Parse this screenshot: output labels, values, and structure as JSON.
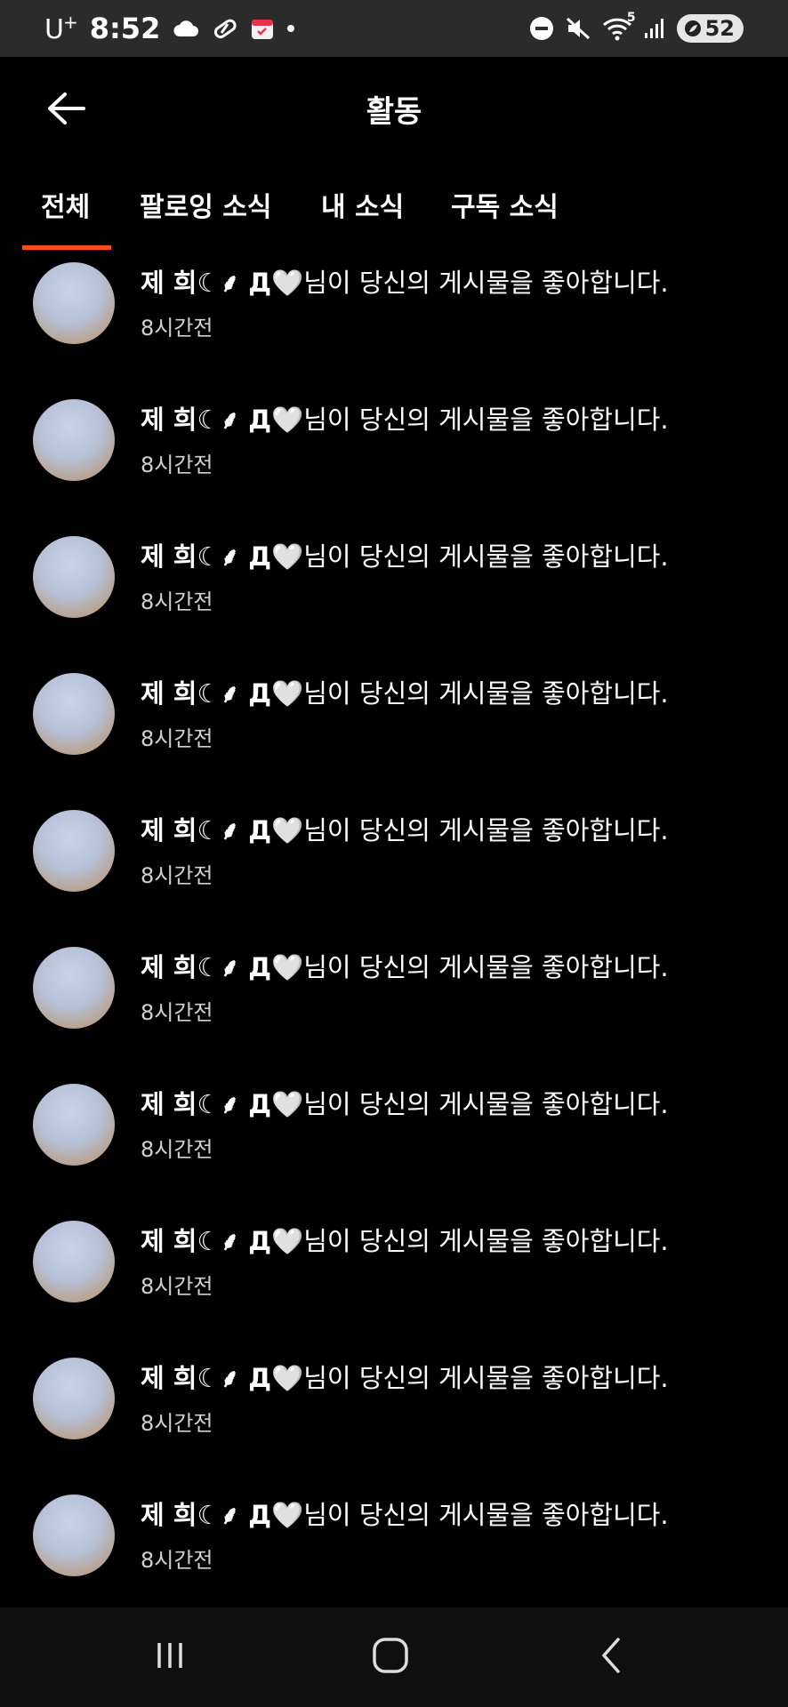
{
  "status_bar": {
    "carrier": "U",
    "carrier_sup": "+",
    "time": "8:52",
    "wifi_badge": "5",
    "battery": "52",
    "icons_left": [
      "cloud-icon",
      "pill-icon",
      "calendar-icon",
      "dot-icon"
    ],
    "icons_right": [
      "do-not-disturb-icon",
      "mute-icon",
      "wifi-icon",
      "signal-icon",
      "battery-icon"
    ]
  },
  "header": {
    "title": "활동"
  },
  "tabs": [
    {
      "label": "전체",
      "active": true
    },
    {
      "label": "팔로잉 소식",
      "active": false
    },
    {
      "label": "내 소식",
      "active": false
    },
    {
      "label": "구독 소식",
      "active": false
    }
  ],
  "notifications": [
    {
      "user": "제 희☾⸙ Д",
      "heart": "🤍",
      "message": "님이 당신의 게시물을 좋아합니다.",
      "time": "8시간전"
    },
    {
      "user": "제 희☾⸙ Д",
      "heart": "🤍",
      "message": "님이 당신의 게시물을 좋아합니다.",
      "time": "8시간전"
    },
    {
      "user": "제 희☾⸙ Д",
      "heart": "🤍",
      "message": "님이 당신의 게시물을 좋아합니다.",
      "time": "8시간전"
    },
    {
      "user": "제 희☾⸙ Д",
      "heart": "🤍",
      "message": "님이 당신의 게시물을 좋아합니다.",
      "time": "8시간전"
    },
    {
      "user": "제 희☾⸙ Д",
      "heart": "🤍",
      "message": "님이 당신의 게시물을 좋아합니다.",
      "time": "8시간전"
    },
    {
      "user": "제 희☾⸙ Д",
      "heart": "🤍",
      "message": "님이 당신의 게시물을 좋아합니다.",
      "time": "8시간전"
    },
    {
      "user": "제 희☾⸙ Д",
      "heart": "🤍",
      "message": "님이 당신의 게시물을 좋아합니다.",
      "time": "8시간전"
    },
    {
      "user": "제 희☾⸙ Д",
      "heart": "🤍",
      "message": "님이 당신의 게시물을 좋아합니다.",
      "time": "8시간전"
    },
    {
      "user": "제 희☾⸙ Д",
      "heart": "🤍",
      "message": "님이 당신의 게시물을 좋아합니다.",
      "time": "8시간전"
    },
    {
      "user": "제 희☾⸙ Д",
      "heart": "🤍",
      "message": "님이 당신의 게시물을 좋아합니다.",
      "time": "8시간전"
    }
  ],
  "colors": {
    "background": "#000000",
    "accent": "#ff4b1f",
    "status_bar": "#2b2b2b",
    "nav_bar": "#0f0f0f"
  }
}
